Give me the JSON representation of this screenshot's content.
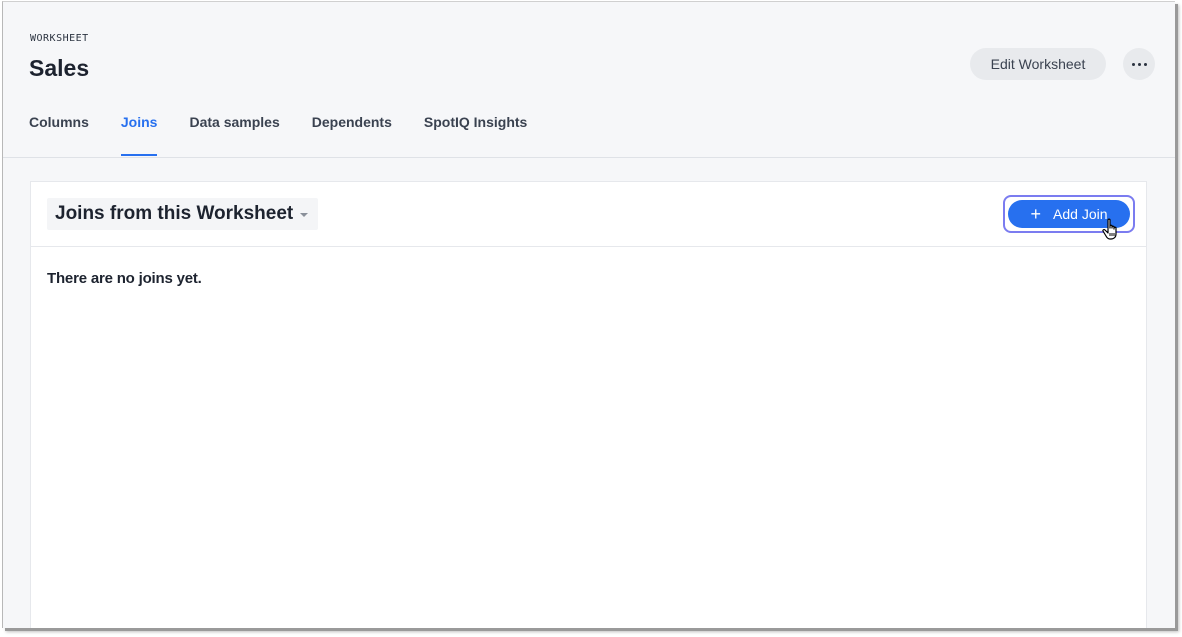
{
  "header": {
    "eyebrow": "WORKSHEET",
    "title": "Sales",
    "edit_button": "Edit Worksheet",
    "more_icon": "more-horizontal-icon"
  },
  "tabs": [
    {
      "label": "Columns",
      "active": false
    },
    {
      "label": "Joins",
      "active": true
    },
    {
      "label": "Data samples",
      "active": false
    },
    {
      "label": "Dependents",
      "active": false
    },
    {
      "label": "SpotIQ Insights",
      "active": false
    }
  ],
  "panel": {
    "dropdown_label": "Joins from this Worksheet",
    "add_button": "Add Join",
    "add_icon": "plus-icon",
    "empty_message": "There are no joins yet."
  },
  "colors": {
    "accent": "#2770ef",
    "focus_ring": "#7b7cf0",
    "background": "#f6f7f9"
  }
}
